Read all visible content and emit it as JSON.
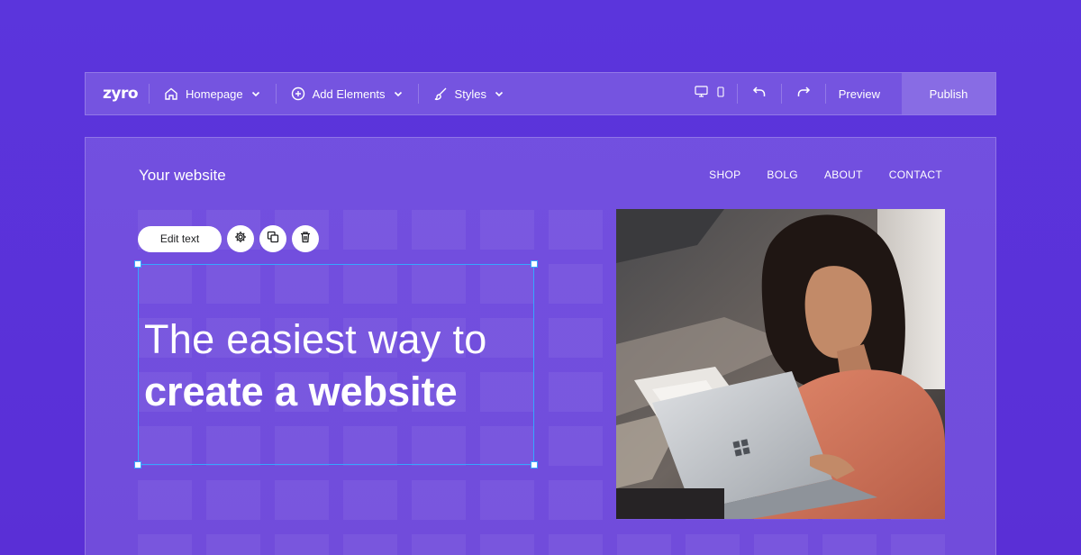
{
  "toolbar": {
    "logo": "zyro",
    "pages_label": "Homepage",
    "add_elements_label": "Add Elements",
    "styles_label": "Styles",
    "preview_label": "Preview",
    "publish_label": "Publish"
  },
  "icons": {
    "home": "home-icon",
    "add": "plus-circle-icon",
    "styles": "brush-icon",
    "desktop": "desktop-icon",
    "mobile": "mobile-icon",
    "undo": "undo-icon",
    "redo": "redo-icon",
    "settings": "gear-icon",
    "duplicate": "duplicate-icon",
    "delete": "trash-icon"
  },
  "site": {
    "title": "Your website",
    "nav": [
      "SHOP",
      "BOLG",
      "ABOUT",
      "CONTACT"
    ]
  },
  "editor": {
    "edit_text_label": "Edit text"
  },
  "hero": {
    "line1": "The easiest way to",
    "line2": "create a website"
  },
  "colors": {
    "background": "#5b35dc",
    "selection": "#36a6ff"
  }
}
